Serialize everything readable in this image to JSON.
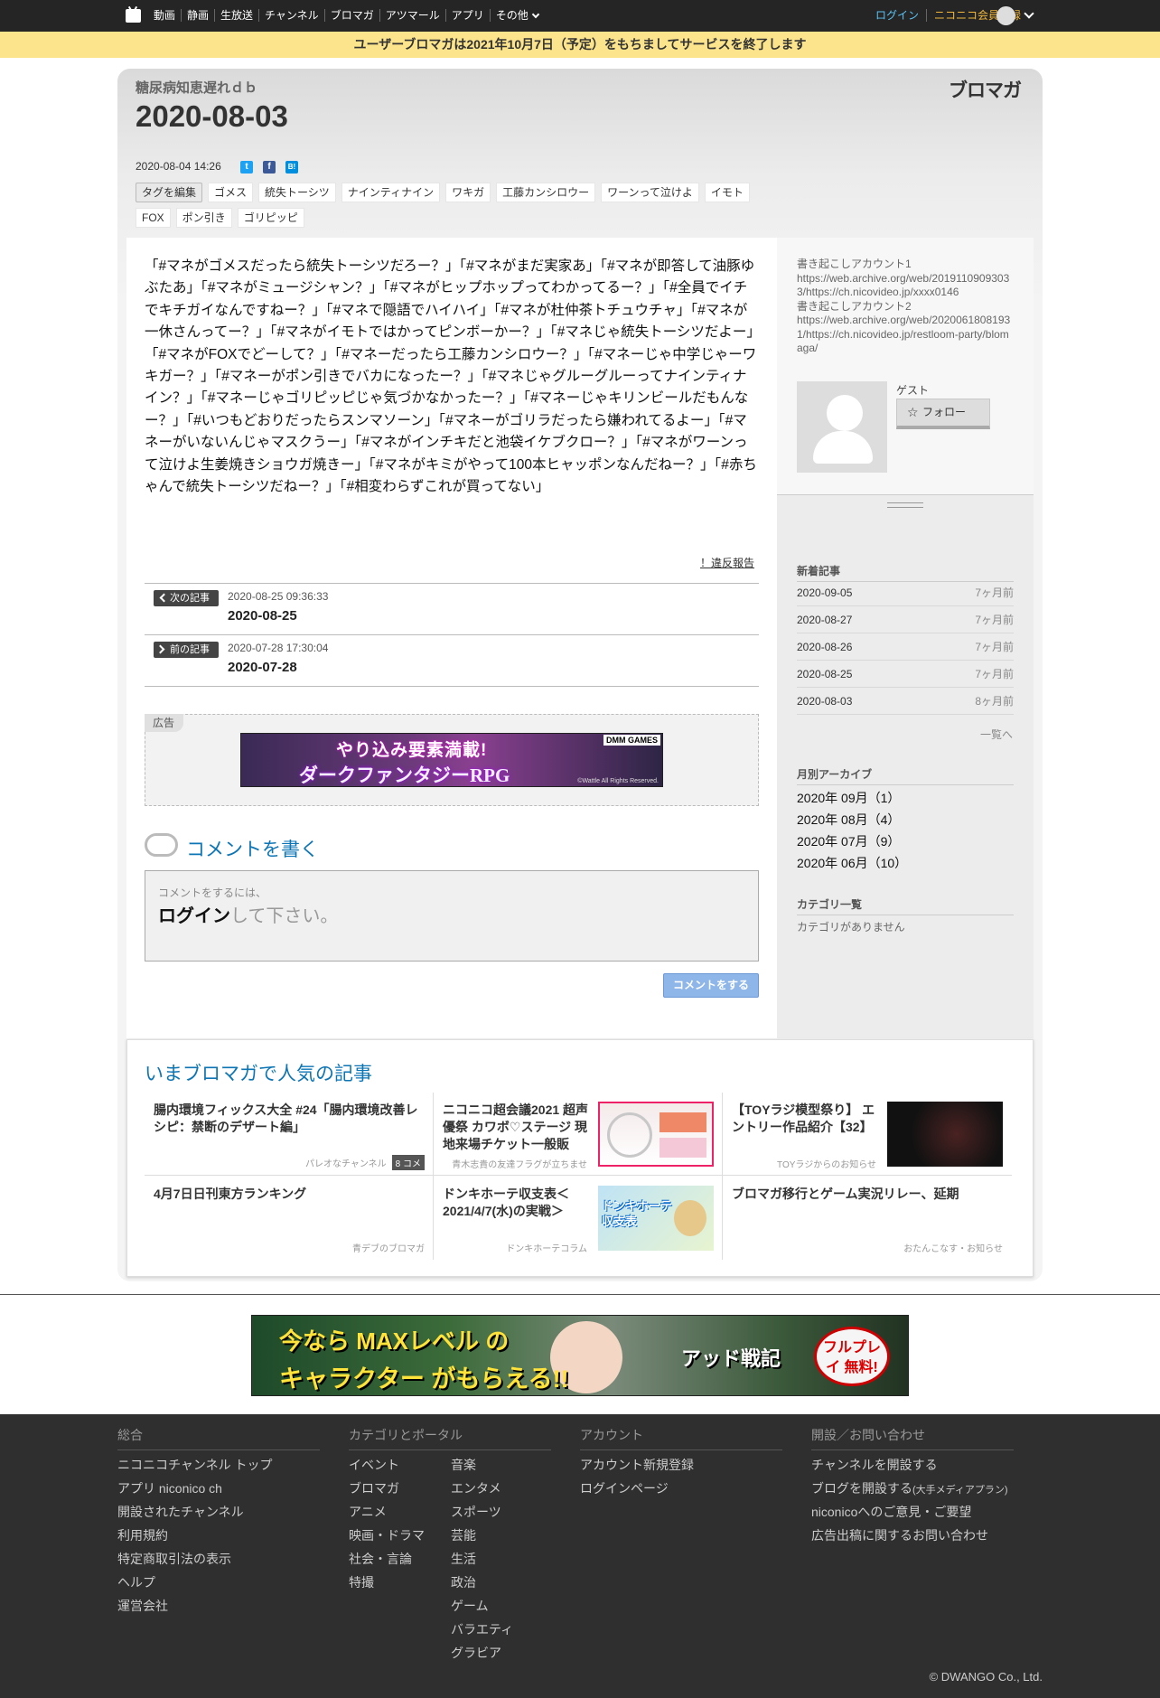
{
  "topbar": {
    "nav": [
      "動画",
      "静画",
      "生放送",
      "チャンネル",
      "ブロマガ",
      "アツマール",
      "アプリ",
      "その他"
    ],
    "login": "ログイン",
    "register": "ニコニコ会員登録"
  },
  "notice": "ユーザーブロマガは2021年10月7日（予定）をもちましてサービスを終了します",
  "header": {
    "blog_name": "糖尿病知恵遅れｄｂ",
    "title": "2020-08-03",
    "brand": "ブロマガ",
    "date": "2020-08-04 14:26"
  },
  "tags": {
    "edit": "タグを編集",
    "items": [
      "ゴメス",
      "統失トーシツ",
      "ナインティナイン",
      "ワキガ",
      "工藤カンシロウー",
      "ワーンって泣けよ",
      "イモト",
      "FOX",
      "ポン引き",
      "ゴリピッピ"
    ]
  },
  "article": {
    "body": "「#マネがゴメスだったら統失トーシツだろー？」「#マネがまだ実家あ」「#マネが即答して油豚ゆぶたあ」「#マネがミュージシャン？」「#マネがヒップホップってわかってるー？」「#全員でイチでキチガイなんですねー？」「#マネで隠語でハイハイ」「#マネが杜仲茶トチュウチャ」「#マネが一休さんってー？」「#マネがイモトではかってピンボーかー？」「#マネじゃ統失トーシツだよー」「#マネがFOXでどーして？」「#マネーだったら工藤カンシロウー？」「#マネーじゃ中学じゃーワキガー？」「#マネーがポン引きでバカになったー？」「#マネじゃグルーグルーってナインティナイン？」「#マネーじゃゴリピッピじゃ気づかなかったー？」「#マネーじゃキリンビールだもんなー？」「#いつもどおりだったらスンマソーン」「#マネーがゴリラだったら嫌われてるよー」「#マネーがいないんじゃマスクうー」「#マネがインチキだと池袋イケブクロー？」「#マネがワーンって泣けよ生姜焼きショウガ焼きー」「#マネがキミがやって100本ヒャッポンなんだねー？」「#赤ちゃんで統失トーシツだねー？」「#相変わらずこれが買ってない」",
    "report": "！違反報告"
  },
  "pager": {
    "next_label": "次の記事",
    "next_date": "2020-08-25 09:36:33",
    "next_title": "2020-08-25",
    "prev_label": "前の記事",
    "prev_date": "2020-07-28 17:30:04",
    "prev_title": "2020-07-28"
  },
  "ad": {
    "label": "広告",
    "text1": "やり込み要素満載!",
    "text2": "ダークファンタジーRPG",
    "badge": "DMM GAMES",
    "copyright": "©Wattle All Rights Reserved."
  },
  "comment": {
    "heading": "コメントを書く",
    "hint": "コメントをするには、",
    "login": "ログイン",
    "login_suffix": "して下さい。",
    "submit": "コメントをする"
  },
  "sidebar": {
    "description_lines": [
      "書き起こしアカウント1",
      "https://web.archive.org/web/20191109093033/https://ch.nicovideo.jp/xxxx0146",
      "書き起こしアカウント2",
      "https://web.archive.org/web/20200618081931/https://ch.nicovideo.jp/restloom-party/blomaga/"
    ],
    "user_name": "ゲスト",
    "follow": "フォロー",
    "recent_heading": "新着記事",
    "recent": [
      {
        "title": "2020-09-05",
        "ago": "7ヶ月前"
      },
      {
        "title": "2020-08-27",
        "ago": "7ヶ月前"
      },
      {
        "title": "2020-08-26",
        "ago": "7ヶ月前"
      },
      {
        "title": "2020-08-25",
        "ago": "7ヶ月前"
      },
      {
        "title": "2020-08-03",
        "ago": "8ヶ月前"
      }
    ],
    "recent_more": "一覧へ",
    "archive_heading": "月別アーカイブ",
    "archive": [
      "2020年 09月（1）",
      "2020年 08月（4）",
      "2020年 07月（9）",
      "2020年 06月（10）"
    ],
    "category_heading": "カテゴリ一覧",
    "category_none": "カテゴリがありません"
  },
  "popular": {
    "heading": "いまブロマガで人気の記事",
    "items": [
      {
        "title": "腸内環境フィックス大全 #24「腸内環境改善レシピ：禁断のデザート編」",
        "source": "パレオなチャンネル",
        "comments": "8 コメ"
      },
      {
        "title": "ニコニコ超会議2021 超声優祭 カワボ♡ステージ 現地来場チケット一般販",
        "source": "青木志貴の友達フラグが立ちませ"
      },
      {
        "title": "【TOYラジ模型祭り】 エントリー作品紹介【32】",
        "source": "TOYラジからのお知らせ"
      },
      {
        "title": "4月7日日刊東方ランキング",
        "source": "青デブのブロマガ"
      },
      {
        "title": "ドンキホーテ収支表＜2021/4/7(水)の実戦＞",
        "source": "ドンキホーテコラム",
        "thumb_text": "ドンキホーテ\n収支表"
      },
      {
        "title": "ブロマガ移行とゲーム実況リレー、延期",
        "source": "おたんこなす・お知らせ"
      }
    ]
  },
  "bottom_ad": {
    "text1": "今なら MAXレベル の",
    "text2": "キャラクター がもらえる!!",
    "text3": "アッド戦記",
    "text4": "フルプレイ 無料!"
  },
  "footer": {
    "col1": {
      "heading": "総合",
      "links": [
        "ニコニコチャンネル トップ",
        "アプリ niconico ch",
        "開設されたチャンネル",
        "利用規約",
        "特定商取引法の表示",
        "ヘルプ",
        "運営会社"
      ]
    },
    "col2": {
      "heading": "カテゴリとポータル",
      "left": [
        "イベント",
        "ブロマガ",
        "アニメ",
        "映画・ドラマ",
        "社会・言論",
        "特撮"
      ],
      "right": [
        "音楽",
        "エンタメ",
        "スポーツ",
        "芸能",
        "生活",
        "政治",
        "ゲーム",
        "バラエティ",
        "グラビア"
      ]
    },
    "col3": {
      "heading": "アカウント",
      "links": [
        "アカウント新規登録",
        "ログインページ"
      ]
    },
    "col4": {
      "heading": "開設／お問い合わせ",
      "links": [
        "チャンネルを開設する",
        "ブログを開設する",
        "niconicoへのご意見・ご要望",
        "広告出稿に関するお問い合わせ"
      ],
      "blog_suffix": "(大手メディアプラン)"
    },
    "copyright": "© DWANGO Co., Ltd."
  },
  "colors": {
    "accent": "#0e75b5",
    "notice": "#fbe48c",
    "login": "#5bc3f5",
    "register": "#f0b63b"
  }
}
